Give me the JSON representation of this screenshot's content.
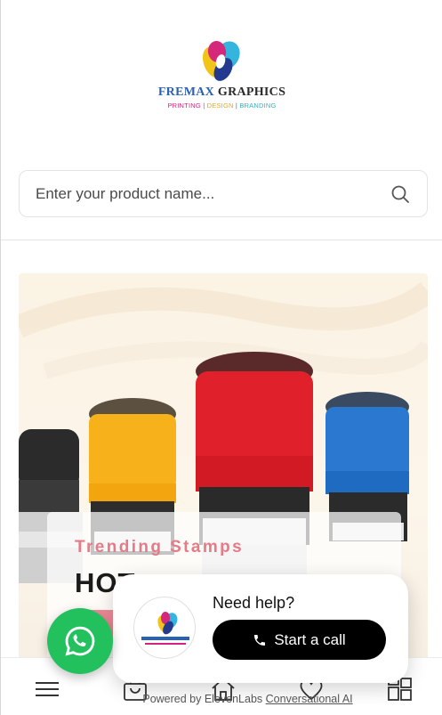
{
  "brand": {
    "name_part1": "FREMAX",
    "name_part2": "GRAPHICS",
    "tagline": [
      "PRINTING",
      "DESIGN",
      "BRANDING"
    ],
    "tagline_separator": "|"
  },
  "search": {
    "placeholder": "Enter your product name..."
  },
  "banner": {
    "subtitle": "Trending Stamps",
    "headline": "HOT"
  },
  "help_widget": {
    "title": "Need help?",
    "call_label": "Start a call",
    "powered_prefix": "Powered by ElevenLabs",
    "powered_link": "Conversational AI"
  },
  "bottom_nav": {
    "icons": [
      "menu-icon",
      "shopping-bag-icon",
      "home-icon",
      "heart-icon",
      "grid-icon"
    ]
  },
  "colors": {
    "whatsapp": "#22c15e",
    "call_button": "#000000",
    "trending_text": "#e47b86",
    "brand_blue": "#2b61b5"
  }
}
